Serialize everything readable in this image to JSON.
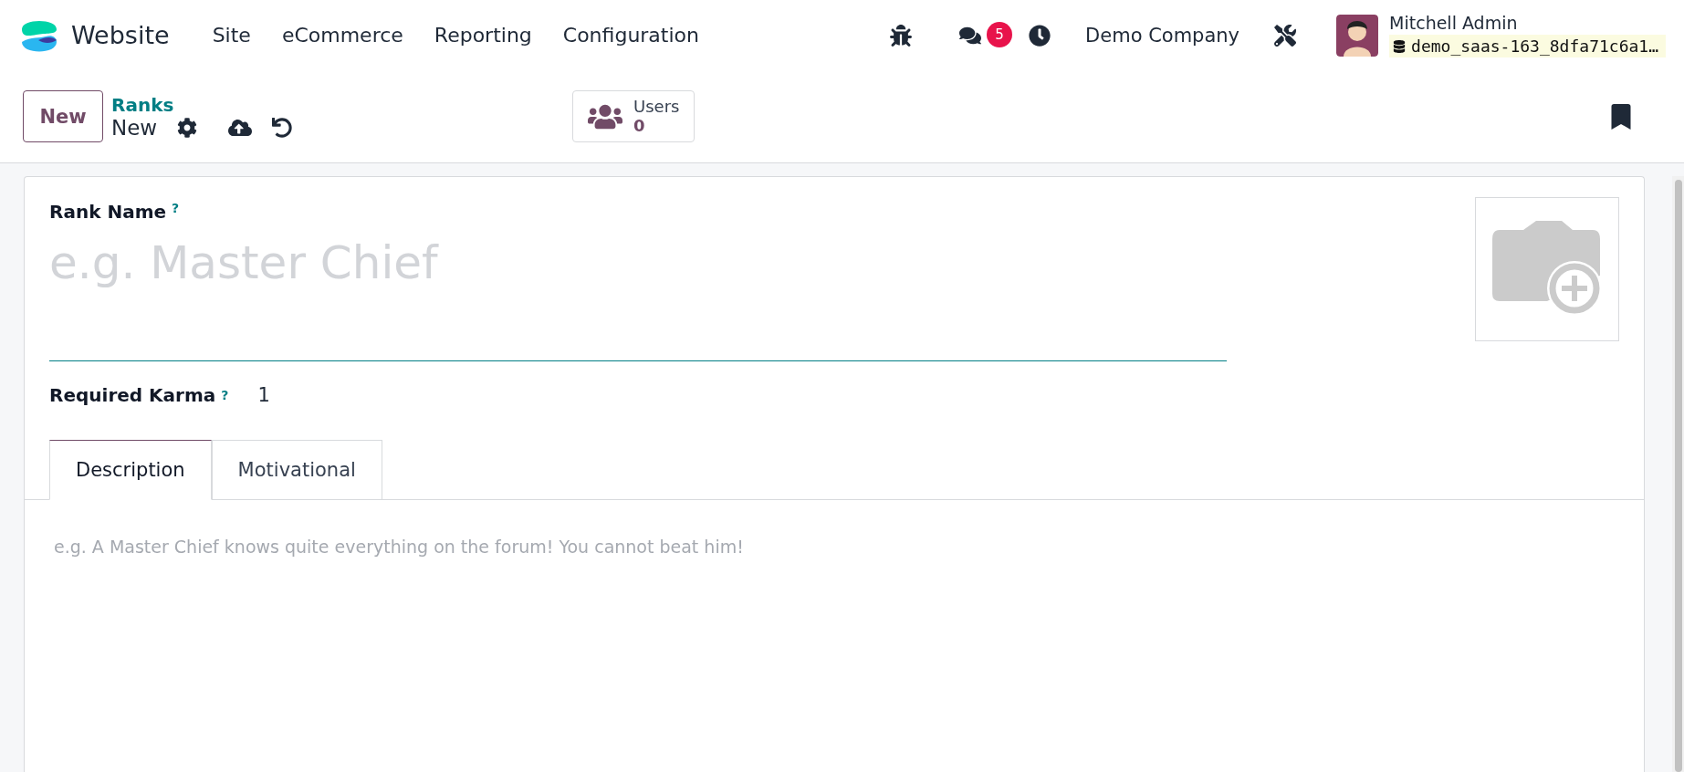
{
  "navbar": {
    "app_name": "Website",
    "menu": [
      "Site",
      "eCommerce",
      "Reporting",
      "Configuration"
    ],
    "messages_badge": "5",
    "company": "Demo Company",
    "user": {
      "name": "Mitchell Admin",
      "database": "demo_saas-163_8dfa71c6a1…"
    }
  },
  "control_panel": {
    "new_button": "New",
    "breadcrumb": {
      "parent": "Ranks",
      "current": "New"
    },
    "stat_button": {
      "label": "Users",
      "value": "0"
    }
  },
  "form": {
    "rank_name": {
      "label": "Rank Name",
      "help": "?",
      "placeholder": "e.g. Master Chief"
    },
    "required_karma": {
      "label": "Required Karma",
      "help": "?",
      "value": "1"
    },
    "tabs": [
      {
        "label": "Description",
        "selected": true
      },
      {
        "label": "Motivational",
        "selected": false
      }
    ],
    "description": {
      "placeholder": "e.g. A Master Chief knows quite everything on the forum! You cannot beat him!"
    }
  }
}
